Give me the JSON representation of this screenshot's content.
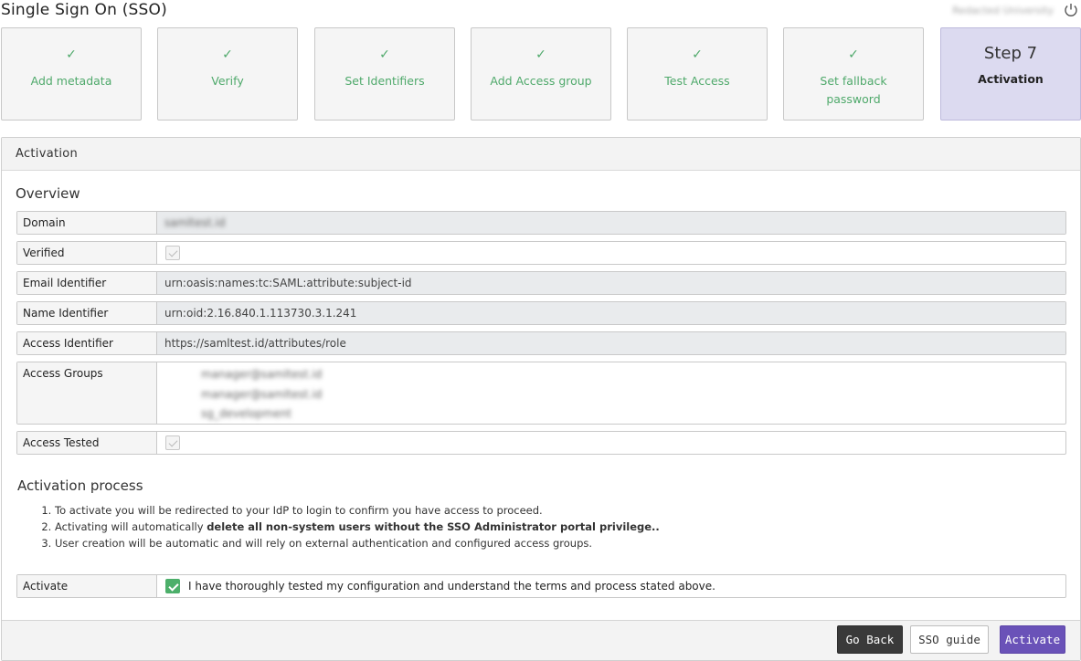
{
  "header": {
    "title": "Single Sign On (SSO)",
    "org_name": "Redacted University"
  },
  "steps": [
    {
      "check": "✓",
      "label": "Add metadata"
    },
    {
      "check": "✓",
      "label": "Verify"
    },
    {
      "check": "✓",
      "label": "Set Identifiers"
    },
    {
      "check": "✓",
      "label": "Add Access group"
    },
    {
      "check": "✓",
      "label": "Test Access"
    },
    {
      "check": "✓",
      "label": "Set fallback password"
    },
    {
      "number": "Step 7",
      "label": "Activation"
    }
  ],
  "panel": {
    "title": "Activation",
    "overview_title": "Overview",
    "fields": {
      "domain": {
        "key": "Domain",
        "value": "samltest.id"
      },
      "verified": {
        "key": "Verified"
      },
      "email_identifier": {
        "key": "Email Identifier",
        "value": "urn:oasis:names:tc:SAML:attribute:subject-id"
      },
      "name_identifier": {
        "key": "Name Identifier",
        "value": "urn:oid:2.16.840.1.113730.3.1.241"
      },
      "access_identifier": {
        "key": "Access Identifier",
        "value": "https://samltest.id/attributes/role"
      },
      "access_groups": {
        "key": "Access Groups",
        "values": [
          "manager@samltest.id",
          "manager@samltest.id",
          "sg_development"
        ]
      },
      "access_tested": {
        "key": "Access Tested"
      }
    },
    "process_title": "Activation process",
    "process_steps": {
      "s1": "To activate you will be redirected to your IdP to login to confirm you have access to proceed.",
      "s2_prefix": "Activating will automatically ",
      "s2_bold": "delete all non-system users without the SSO Administrator portal privilege..",
      "s3": "User creation will be automatic and will rely on external authentication and configured access groups."
    },
    "activate": {
      "key": "Activate",
      "checkbox_label": "I have thoroughly tested my configuration and understand the terms and process stated above.",
      "checked": true
    }
  },
  "footer": {
    "go_back": "Go Back",
    "sso_guide": "SSO guide",
    "activate": "Activate"
  },
  "colors": {
    "accent": "#6a52b8",
    "success": "#4fa96b",
    "active_step": "#dcdaf0"
  }
}
